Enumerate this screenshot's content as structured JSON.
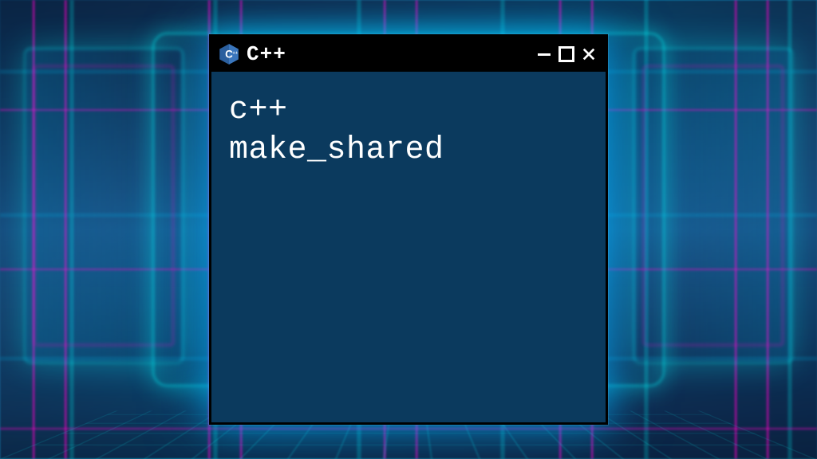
{
  "window": {
    "title": "C++",
    "icon_name": "cpp-logo-icon",
    "content_lines": {
      "line1": "c++",
      "line2": "make_shared"
    }
  },
  "colors": {
    "window_bg": "#0b3a5e",
    "titlebar_bg": "#000000",
    "text": "#ffffff",
    "glow_cyan": "#00e5ff",
    "glow_magenta": "#ff00c8"
  }
}
